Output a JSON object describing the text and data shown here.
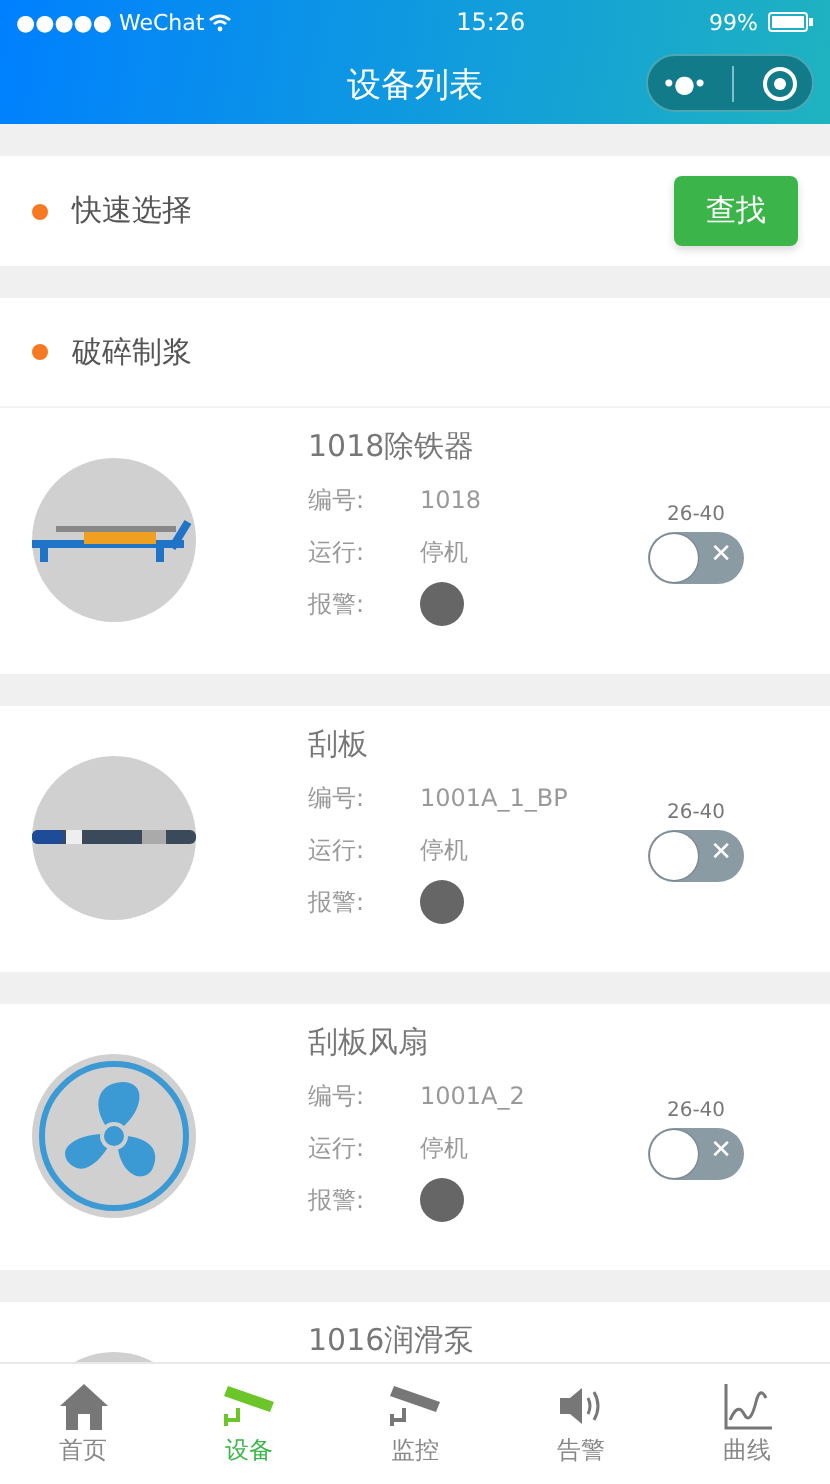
{
  "status_bar": {
    "carrier": "●●●●● WeChat",
    "time": "15:26",
    "battery": "99%"
  },
  "nav": {
    "title": "设备列表",
    "menu": "•●•"
  },
  "quick_select": {
    "label": "快速选择",
    "button": "查找"
  },
  "section": {
    "title": "破碎制浆"
  },
  "devices": [
    {
      "kind": "magnet",
      "name": "1018除铁器",
      "id_label": "编号:",
      "id": "1018",
      "run_label": "运行:",
      "run": "停机",
      "alarm_label": "报警:",
      "alarm": false,
      "range": "26-40",
      "on": false,
      "off_mark": "✕"
    },
    {
      "kind": "scraper",
      "name": "刮板",
      "id_label": "编号:",
      "id": "1001A_1_BP",
      "run_label": "运行:",
      "run": "停机",
      "alarm_label": "报警:",
      "alarm": false,
      "range": "26-40",
      "on": false,
      "off_mark": "✕"
    },
    {
      "kind": "fan",
      "name": "刮板风扇",
      "id_label": "编号:",
      "id": "1001A_2",
      "run_label": "运行:",
      "run": "停机",
      "alarm_label": "报警:",
      "alarm": false,
      "range": "26-40",
      "on": false,
      "off_mark": "✕"
    },
    {
      "kind": "pump",
      "name": "1016润滑泵"
    }
  ],
  "tabbar": [
    {
      "kind": "home",
      "label": "首页",
      "selected": false
    },
    {
      "kind": "camera",
      "label": "设备",
      "selected": true
    },
    {
      "kind": "camera",
      "label": "监控",
      "selected": false
    },
    {
      "kind": "speaker",
      "label": "告警",
      "selected": false
    },
    {
      "kind": "chart",
      "label": "曲线",
      "selected": false
    }
  ]
}
